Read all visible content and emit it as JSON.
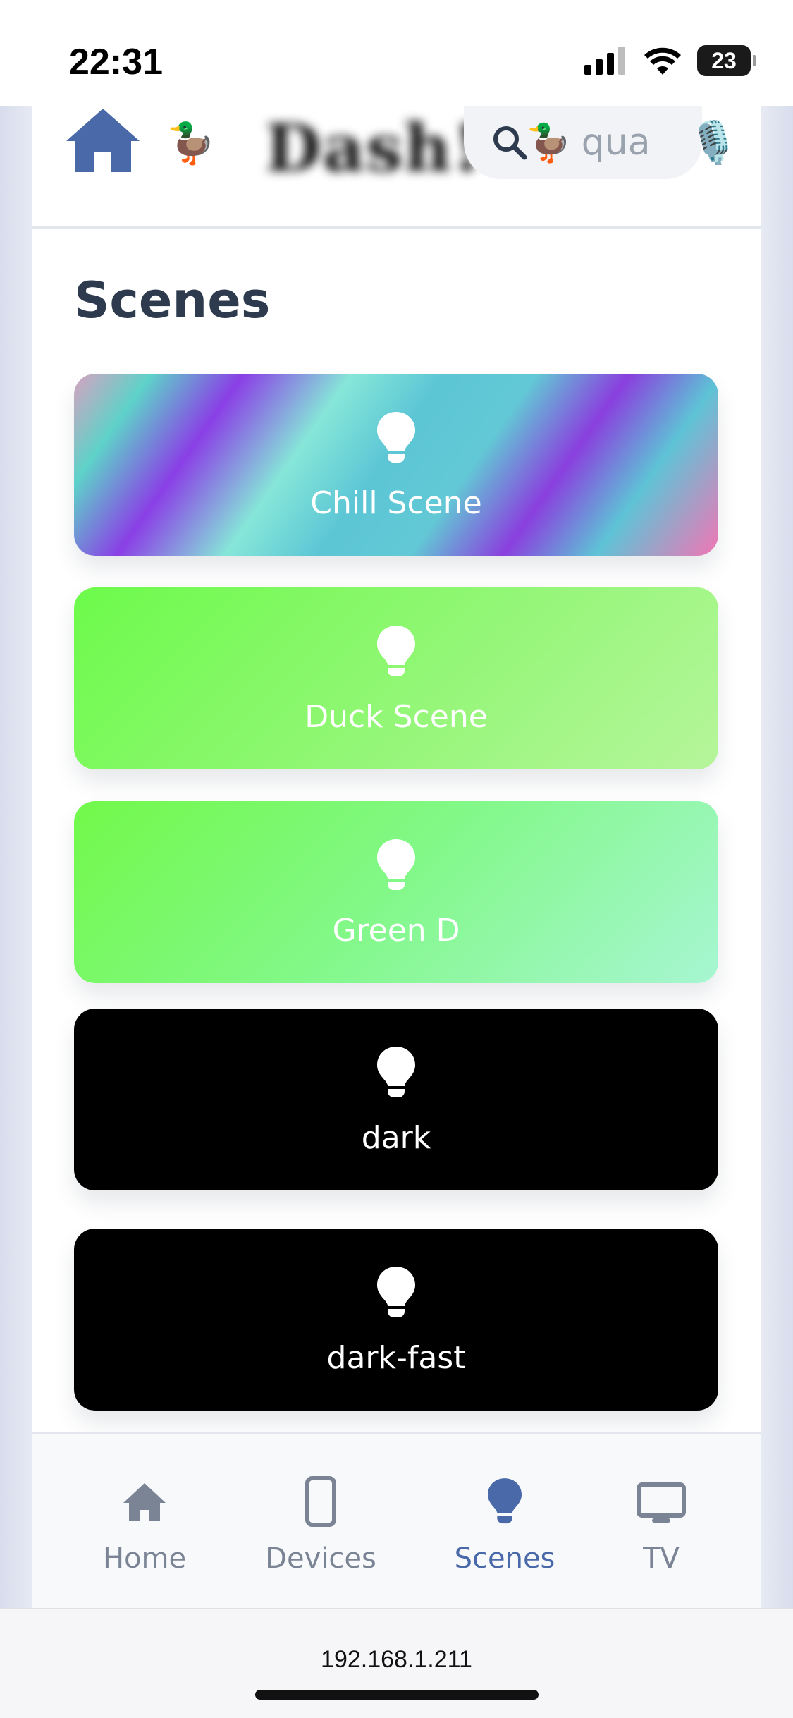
{
  "status_bar": {
    "time": "22:31",
    "battery": "23",
    "icons": [
      "signal-icon",
      "wifi-icon",
      "battery-icon"
    ]
  },
  "header": {
    "logo_icon": "home-icon",
    "duck_emoji": "🦆",
    "brand_text": "Dash!",
    "search": {
      "duck_emoji": "🦆",
      "placeholder": "qua"
    },
    "mic_emoji": "🎙️"
  },
  "main": {
    "title": "Scenes",
    "scenes": [
      {
        "label": "Chill Scene",
        "icon": "lightbulb-icon",
        "style": "rainbow"
      },
      {
        "label": "Duck Scene",
        "icon": "lightbulb-icon",
        "style": "green"
      },
      {
        "label": "Green D",
        "icon": "lightbulb-icon",
        "style": "green-teal"
      },
      {
        "label": "dark",
        "icon": "lightbulb-icon",
        "style": "black"
      },
      {
        "label": "dark-fast",
        "icon": "lightbulb-icon",
        "style": "black"
      }
    ]
  },
  "bottom_nav": {
    "active": "Scenes",
    "items": [
      {
        "label": "Home",
        "icon": "home-icon"
      },
      {
        "label": "Devices",
        "icon": "phone-icon"
      },
      {
        "label": "Scenes",
        "icon": "lightbulb-icon"
      },
      {
        "label": "TV",
        "icon": "tv-icon"
      }
    ]
  },
  "browser": {
    "url": "192.168.1.211"
  },
  "colors": {
    "accent": "#4a69a8",
    "title": "#2e3a4e",
    "nav_inactive": "#7a8495"
  }
}
